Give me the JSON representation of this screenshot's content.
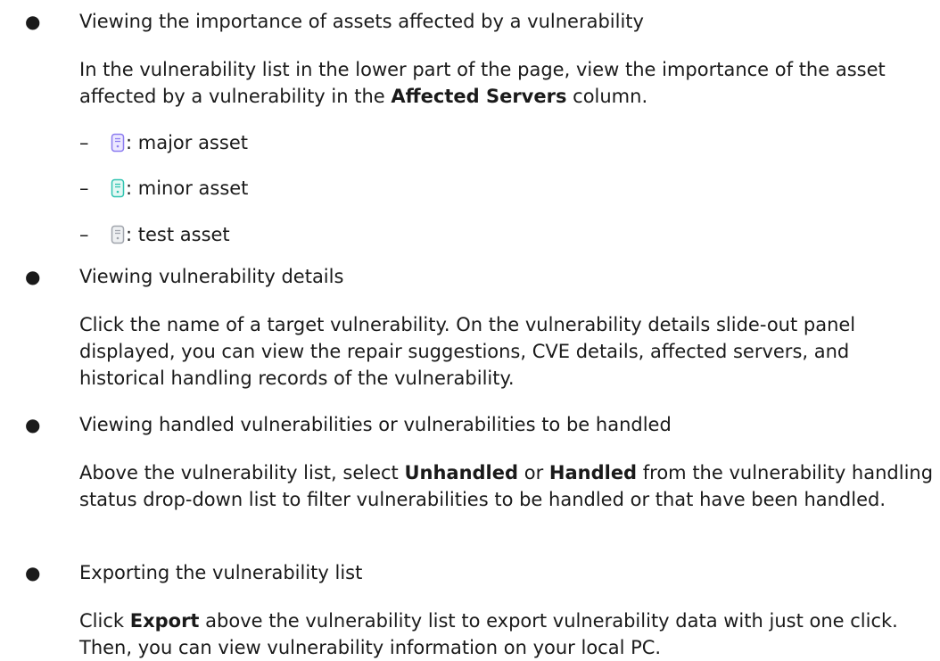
{
  "bullets": {
    "b1": {
      "heading": "Viewing the importance of assets affected by a vulnerability",
      "para_part1": "In the vulnerability list in the lower part of the page, view the importance of the asset affected by a vulnerability in the ",
      "para_bold1": "Affected Servers",
      "para_part2": " column."
    },
    "b2": {
      "heading": "Viewing vulnerability details",
      "para": "Click the name of a target vulnerability. On the vulnerability details slide-out panel displayed, you can view the repair suggestions, CVE details, affected servers, and historical handling records of the vulnerability."
    },
    "b3": {
      "heading": "Viewing handled vulnerabilities or vulnerabilities to be handled",
      "para_part1": "Above the vulnerability list, select ",
      "para_bold1": "Unhandled",
      "para_part2": " or ",
      "para_bold2": "Handled",
      "para_part3": " from the vulnerability handling status drop-down list to filter vulnerabilities to be handled or that have been handled."
    },
    "b4": {
      "heading": "Exporting the vulnerability list",
      "para_part1": "Click ",
      "para_bold1": "Export",
      "para_part2": " above the vulnerability list to export vulnerability data with just one click. Then, you can view vulnerability information on your local PC."
    }
  },
  "bullet_char": "●",
  "dash_char": "–",
  "asset_levels": [
    {
      "label": ": major asset",
      "icon": "server-icon",
      "color": "#8c7cf0",
      "fill": "#ece8ff"
    },
    {
      "label": ": minor asset",
      "icon": "server-icon",
      "color": "#2fc3b0",
      "fill": "#e3f8f4"
    },
    {
      "label": ": test asset",
      "icon": "server-icon",
      "color": "#a0a4ac",
      "fill": "#eef0f2"
    }
  ]
}
